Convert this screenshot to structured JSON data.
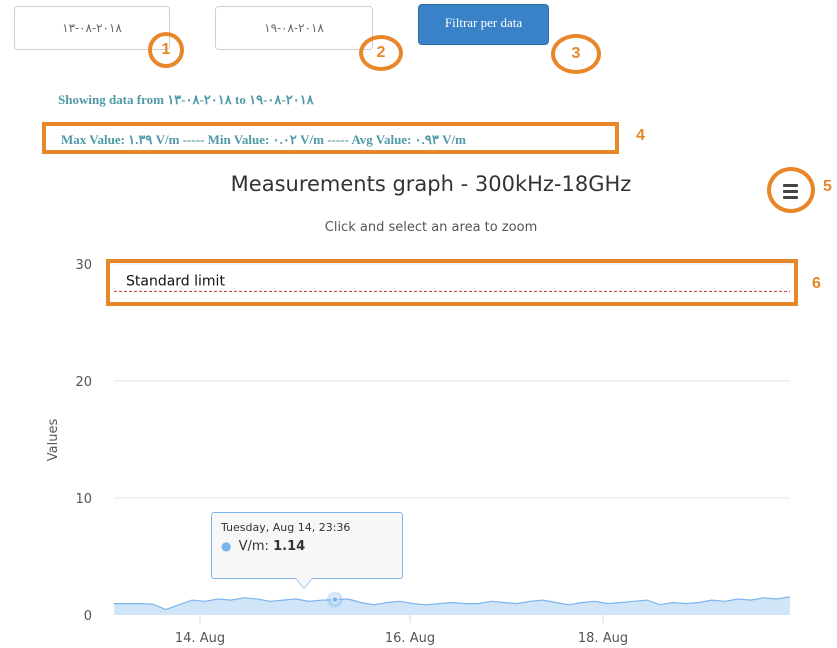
{
  "filters": {
    "start_date": "٢٠١٨-٠٨-١٣",
    "end_date": "٢٠١٨-٠٨-١٩",
    "filter_button_label": "Filtrar per data"
  },
  "info": {
    "showing_text": "Showing data from ٢٠١٨-٠٨-١٣ to ٢٠١٨-٠٨-١٩",
    "stats_text": "Max Value: ١.٣٩ V/m ----- Min Value: ٠.٠٢ V/m ----- Avg Value: ٠.٩٣ V/m"
  },
  "callouts": [
    "1",
    "2",
    "3",
    "4",
    "5",
    "6"
  ],
  "chart": {
    "title": "Measurements graph - 300kHz-18GHz",
    "subtitle": "Click and select an area to zoom",
    "menu_icon": "hamburger-icon",
    "tooltip": {
      "time": "Tuesday, Aug 14, 23:36",
      "series_label": "V/m:",
      "value": "1.14"
    }
  },
  "chart_data": {
    "type": "area",
    "ylabel": "Values",
    "ylim": [
      0,
      30
    ],
    "yticks": [
      "0",
      "10",
      "20",
      "30"
    ],
    "xticks": [
      "14. Aug",
      "16. Aug",
      "18. Aug"
    ],
    "plot_lines": [
      {
        "label": "Standard limit",
        "value": 28
      }
    ],
    "series": [
      {
        "name": "V/m",
        "values": [
          0.8,
          0.8,
          0.8,
          0.75,
          0.3,
          0.7,
          1.1,
          1.0,
          1.2,
          1.1,
          1.3,
          1.2,
          1.0,
          1.1,
          1.2,
          1.0,
          1.1,
          1.14,
          1.2,
          0.9,
          0.7,
          0.9,
          1.0,
          0.8,
          0.7,
          0.8,
          0.9,
          0.8,
          0.8,
          1.0,
          0.9,
          0.8,
          1.0,
          1.1,
          0.9,
          0.7,
          0.9,
          1.0,
          0.8,
          0.9,
          1.0,
          1.1,
          0.7,
          0.9,
          0.8,
          0.9,
          1.1,
          1.0,
          1.2,
          1.1,
          1.3,
          1.2,
          1.39
        ]
      }
    ],
    "colors": {
      "series": "#7cb5ec",
      "limit": "#c0392b",
      "callout": "#e8862a"
    }
  }
}
